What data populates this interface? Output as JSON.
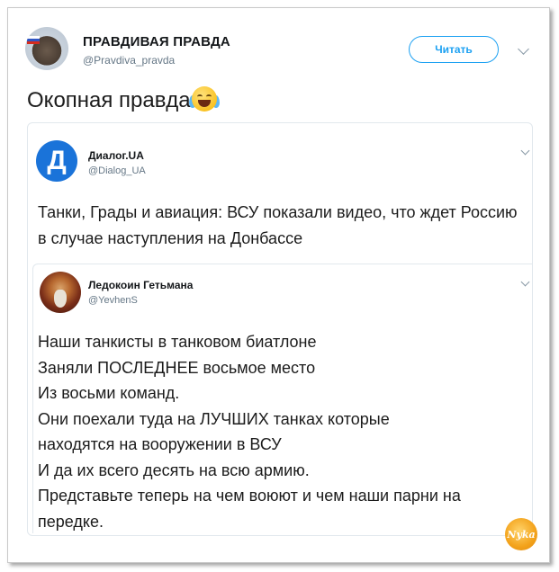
{
  "tweet": {
    "author_name": "ПРАВДИВАЯ ПРАВДА",
    "author_handle": "@Pravdiva_pravda",
    "follow_label": "Читать",
    "text": "Окопная правда",
    "emoji": "face-with-tears-of-joy-emoji"
  },
  "quoted_tweet": {
    "logo_letter": "Д",
    "author_name": "Диалог.UA",
    "author_handle": "@Dialog_UA",
    "text": "Танки, Грады и авиация: ВСУ показали видео, что ждет Россию в случае наступления на Донбассе"
  },
  "nested_quote": {
    "author_name": "Ледокоин Гетьмана",
    "author_handle": "@YevhenS",
    "lines": [
      "Наши танкисты в танковом биатлоне",
      "Заняли ПОСЛЕДНЕЕ восьмое место",
      "Из восьми команд.",
      "Они поехали туда на ЛУЧШИХ танках которые",
      "находятся на вооружении в ВСУ",
      "И да их всего десять на всю армию.",
      "Представьте теперь на чем воюют и чем наши парни на",
      "передке."
    ]
  },
  "watermark": "Nyka",
  "colors": {
    "accent": "#1da1f2",
    "dialog_logo": "#1a73d9",
    "secondary_text": "#657786"
  }
}
